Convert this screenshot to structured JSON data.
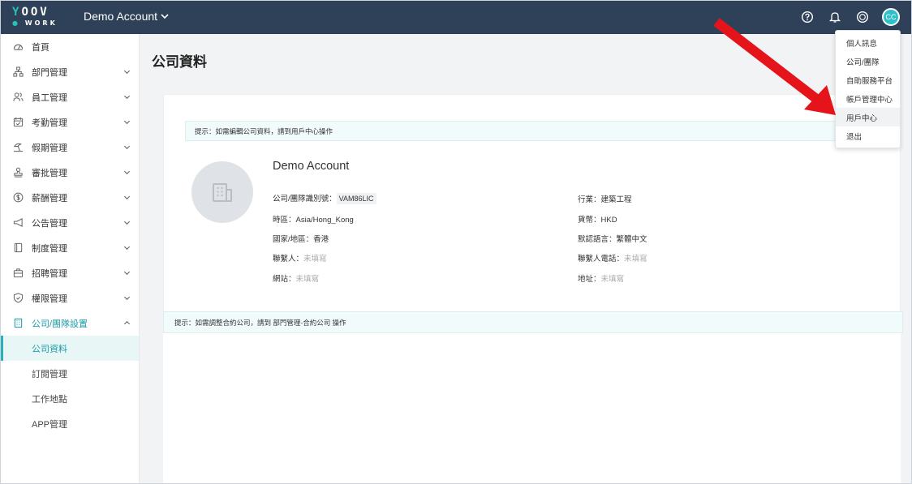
{
  "header": {
    "logo_top": "YOOV",
    "logo_bottom": "WORK",
    "account_name": "Demo Account",
    "avatar_initials": "CC",
    "icons": [
      "help-icon",
      "bell-icon",
      "coins-icon",
      "avatar"
    ]
  },
  "sidebar": {
    "items": [
      {
        "label": "首頁",
        "icon": "dashboard-icon"
      },
      {
        "label": "部門管理",
        "icon": "org-chart-icon"
      },
      {
        "label": "員工管理",
        "icon": "people-icon"
      },
      {
        "label": "考勤管理",
        "icon": "calendar-check-icon"
      },
      {
        "label": "假期管理",
        "icon": "beach-icon"
      },
      {
        "label": "審批管理",
        "icon": "stamp-icon"
      },
      {
        "label": "薪酬管理",
        "icon": "dollar-icon"
      },
      {
        "label": "公告管理",
        "icon": "megaphone-icon"
      },
      {
        "label": "制度管理",
        "icon": "book-icon"
      },
      {
        "label": "招聘管理",
        "icon": "briefcase-icon"
      },
      {
        "label": "權限管理",
        "icon": "shield-icon"
      },
      {
        "label": "公司/團隊設置",
        "icon": "building-icon"
      }
    ],
    "sub_items": [
      "公司資料",
      "訂閱管理",
      "工作地點",
      "APP管理"
    ]
  },
  "main": {
    "page_title": "公司資料",
    "hint_top": "提示：如需編輯公司資料，請到用戶中心操作",
    "company_name": "Demo Account",
    "fields": {
      "team_id_label": "公司/團隊識別號：",
      "team_id_value": "VAM86LIC",
      "timezone_label": "時區：",
      "timezone_value": "Asia/Hong_Kong",
      "country_label": "國家/地區：",
      "country_value": "香港",
      "contact_label": "聯繫人：",
      "contact_value": "未填寫",
      "website_label": "網站：",
      "website_value": "未填寫",
      "industry_label": "行業：",
      "industry_value": "建築工程",
      "currency_label": "貨幣：",
      "currency_value": "HKD",
      "language_label": "默認語言：",
      "language_value": "繁體中文",
      "contact_phone_label": "聯繫人電話：",
      "contact_phone_value": "未填寫",
      "address_label": "地址：",
      "address_value": "未填寫"
    },
    "hint_bottom": "提示：如需調整合約公司，請到 部門管理-合約公司 操作"
  },
  "dropdown": {
    "items": [
      "個人訊息",
      "公司/團隊",
      "自助服務平台",
      "帳戶管理中心",
      "用戶中心",
      "退出"
    ]
  },
  "colors": {
    "header_bg": "#2f4158",
    "accent": "#1b9aa5",
    "arrow": "#e5141a"
  }
}
